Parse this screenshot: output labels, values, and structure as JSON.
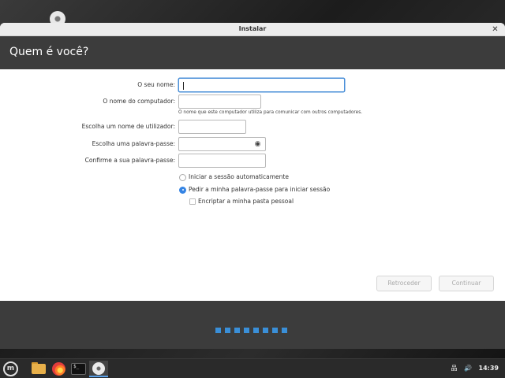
{
  "window": {
    "title": "Instalar",
    "close_glyph": "✕"
  },
  "header": {
    "title": "Quem é você?"
  },
  "form": {
    "name_label": "O seu nome:",
    "name_value": "",
    "computer_label": "O nome do computador:",
    "computer_value": "",
    "computer_hint": "O nome que este computador utiliza para comunicar com outros computadores.",
    "username_label": "Escolha um nome de utilizador:",
    "username_value": "",
    "password_label": "Escolha uma palavra-passe:",
    "password_value": "",
    "confirm_label": "Confirme a sua palavra-passe:",
    "confirm_value": ""
  },
  "options": {
    "auto_login_label": "Iniciar a sessão automaticamente",
    "auto_login_selected": false,
    "require_password_label": "Pedir a minha palavra-passe para iniciar sessão",
    "require_password_selected": true,
    "encrypt_home_label": "Encriptar a minha pasta pessoal",
    "encrypt_home_checked": false
  },
  "buttons": {
    "back_label": "Retroceder",
    "continue_label": "Continuar"
  },
  "progress": {
    "steps": 8,
    "icon": "progress-dot"
  },
  "taskbar": {
    "menu_glyph": "m",
    "terminal_glyph": "$_",
    "volume_glyph": "🔊",
    "network_glyph": "品",
    "clock": "14:39"
  }
}
